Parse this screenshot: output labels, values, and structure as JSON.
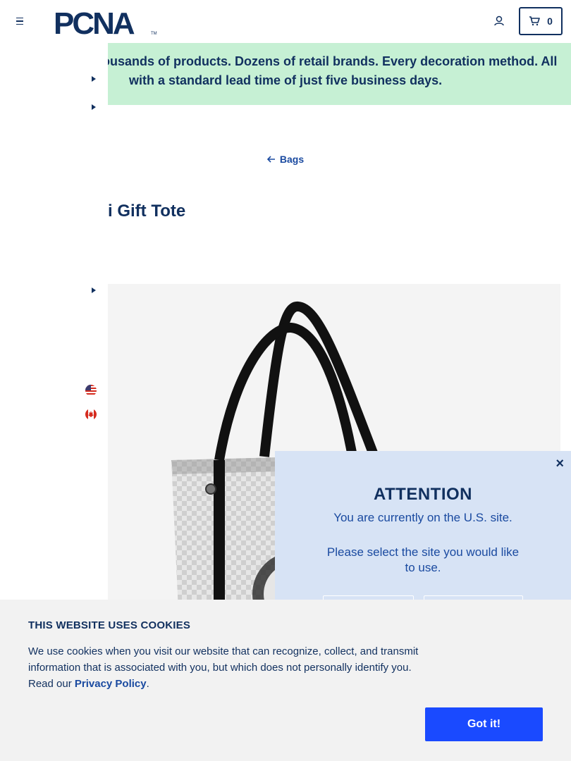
{
  "header": {
    "menu_icon": "hamburger-menu-icon",
    "logo_text": "PCNA",
    "logo_trademark": "TM",
    "account_icon": "user-icon",
    "cart_icon": "cart-icon",
    "cart_count": "0"
  },
  "promo": {
    "line1": "Thousands of products. Dozens of retail brands. Every decoration method. All",
    "line2": "with a standard lead time of just five business days."
  },
  "breadcrumb": {
    "icon": "arrow-left-icon",
    "label": "Bags"
  },
  "product": {
    "title": "i Gift Tote"
  },
  "flags": {
    "us": "us-flag-icon",
    "ca": "canada-flag-icon"
  },
  "attention": {
    "close": "×",
    "title": "ATTENTION",
    "message": "You are currently on the U.S. site.",
    "prompt": "Please select the site you would like to use.",
    "button_us": "",
    "button_ca": ""
  },
  "cookie": {
    "title": "THIS WEBSITE USES COOKIES",
    "text_before": "We use cookies when you visit our website that can recognize, collect, and transmit information that is associated with you, but which does not personally identify you. Read our ",
    "link": "Privacy Policy",
    "text_after": ".",
    "button": "Got it!"
  },
  "colors": {
    "brand_navy": "#11305f",
    "brand_blue": "#1a4aa0",
    "promo_bg": "#c6f0d4",
    "attention_bg": "#d7e3f5",
    "cookie_bg": "#f2f2f2",
    "cookie_button": "#1a4aff"
  }
}
